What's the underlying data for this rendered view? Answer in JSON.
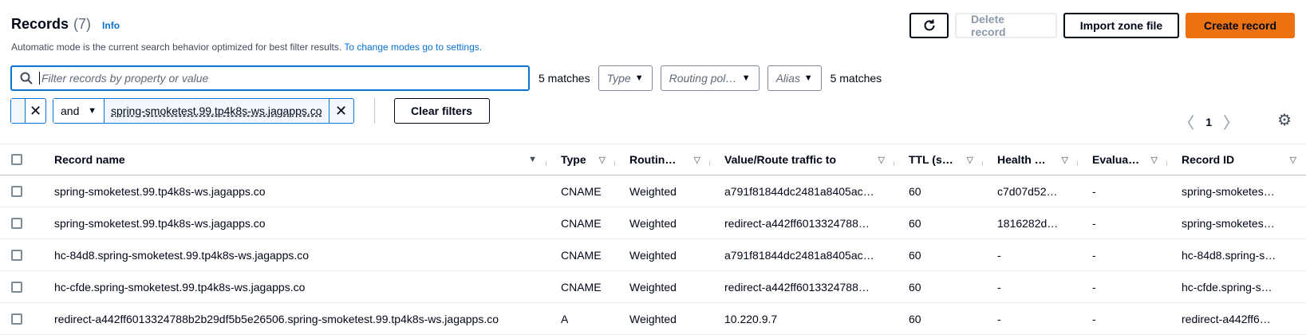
{
  "header": {
    "title": "Records",
    "count": "(7)",
    "info": "Info"
  },
  "description": {
    "text": "Automatic mode is the current search behavior optimized for best filter results. ",
    "link": "To change modes go to settings."
  },
  "actions": {
    "delete": "Delete record",
    "import": "Import zone file",
    "create": "Create record"
  },
  "filter": {
    "placeholder": "Filter records by property or value",
    "matches": "5 matches",
    "type_select": "Type",
    "routing_select": "Routing pol…",
    "alias_select": "Alias",
    "matches_after": "5 matches"
  },
  "tokens": {
    "operator": "and",
    "value": "spring-smoketest.99.tp4k8s-ws.jagapps.co",
    "clear": "Clear filters"
  },
  "pagination": {
    "page": "1"
  },
  "table": {
    "headers": [
      "Record name",
      "Type",
      "Routin…",
      "Value/Route traffic to",
      "TTL (s…",
      "Health …",
      "Evalua…",
      "Record ID"
    ],
    "rows": [
      [
        "spring-smoketest.99.tp4k8s-ws.jagapps.co",
        "CNAME",
        "Weighted",
        "a791f81844dc2481a8405ac…",
        "60",
        "c7d07d52…",
        "-",
        "spring-smoketes…"
      ],
      [
        "spring-smoketest.99.tp4k8s-ws.jagapps.co",
        "CNAME",
        "Weighted",
        "redirect-a442ff6013324788…",
        "60",
        "1816282d…",
        "-",
        "spring-smoketes…"
      ],
      [
        "hc-84d8.spring-smoketest.99.tp4k8s-ws.jagapps.co",
        "CNAME",
        "Weighted",
        "a791f81844dc2481a8405ac…",
        "60",
        "-",
        "-",
        "hc-84d8.spring-s…"
      ],
      [
        "hc-cfde.spring-smoketest.99.tp4k8s-ws.jagapps.co",
        "CNAME",
        "Weighted",
        "redirect-a442ff6013324788…",
        "60",
        "-",
        "-",
        "hc-cfde.spring-s…"
      ],
      [
        "redirect-a442ff6013324788b2b29df5b5e26506.spring-smoketest.99.tp4k8s-ws.jagapps.co",
        "A",
        "Weighted",
        "10.220.9.7",
        "60",
        "-",
        "-",
        "redirect-a442ff6…"
      ]
    ]
  },
  "icons": {
    "refresh": "refresh-icon",
    "search": "search-icon",
    "close": "close-icon",
    "caret": "caret-down-icon",
    "settings": "gear-icon"
  },
  "colors": {
    "primary": "#ec7211",
    "link": "#0972d3"
  }
}
